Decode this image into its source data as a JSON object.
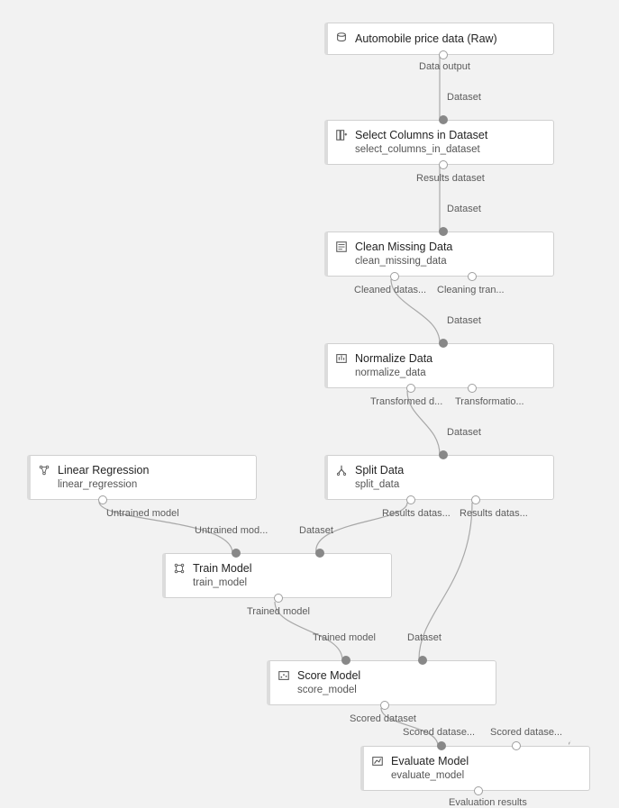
{
  "nodes": {
    "automobile": {
      "title": "Automobile price data (Raw)",
      "subtitle": ""
    },
    "select_cols": {
      "title": "Select Columns in Dataset",
      "subtitle": "select_columns_in_dataset"
    },
    "clean": {
      "title": "Clean Missing Data",
      "subtitle": "clean_missing_data"
    },
    "normalize": {
      "title": "Normalize Data",
      "subtitle": "normalize_data"
    },
    "linreg": {
      "title": "Linear Regression",
      "subtitle": "linear_regression"
    },
    "split": {
      "title": "Split Data",
      "subtitle": "split_data"
    },
    "train": {
      "title": "Train Model",
      "subtitle": "train_model"
    },
    "score": {
      "title": "Score Model",
      "subtitle": "score_model"
    },
    "evaluate": {
      "title": "Evaluate Model",
      "subtitle": "evaluate_model"
    }
  },
  "port_labels": {
    "automobile_out": "Data output",
    "select_in": "Dataset",
    "select_out": "Results dataset",
    "clean_in": "Dataset",
    "clean_out1": "Cleaned datas...",
    "clean_out2": "Cleaning tran...",
    "normalize_in": "Dataset",
    "normalize_out1": "Transformed d...",
    "normalize_out2": "Transformatio...",
    "split_in": "Dataset",
    "split_out1": "Results datas...",
    "split_out2": "Results datas...",
    "linreg_out": "Untrained model",
    "train_in1": "Untrained mod...",
    "train_in2": "Dataset",
    "train_out": "Trained model",
    "score_in1": "Trained model",
    "score_in2": "Dataset",
    "score_out": "Scored dataset",
    "evaluate_in1": "Scored datase...",
    "evaluate_in2": "Scored datase...",
    "evaluate_out": "Evaluation results"
  }
}
